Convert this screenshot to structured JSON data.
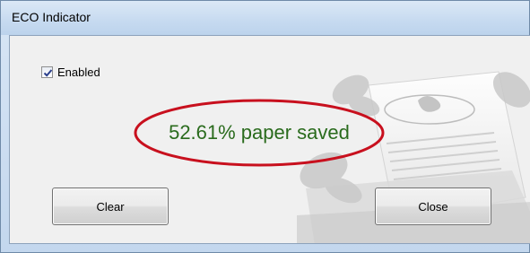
{
  "window": {
    "title": "ECO Indicator"
  },
  "checkbox": {
    "label": "Enabled",
    "checked": true
  },
  "status": {
    "text": "52.61% paper saved",
    "color": "#2a6b1d",
    "highlight_color": "#c8101e"
  },
  "buttons": {
    "clear_label": "Clear",
    "close_label": "Close"
  },
  "watermark": {
    "icon": "printer-butterfly-watermark"
  }
}
